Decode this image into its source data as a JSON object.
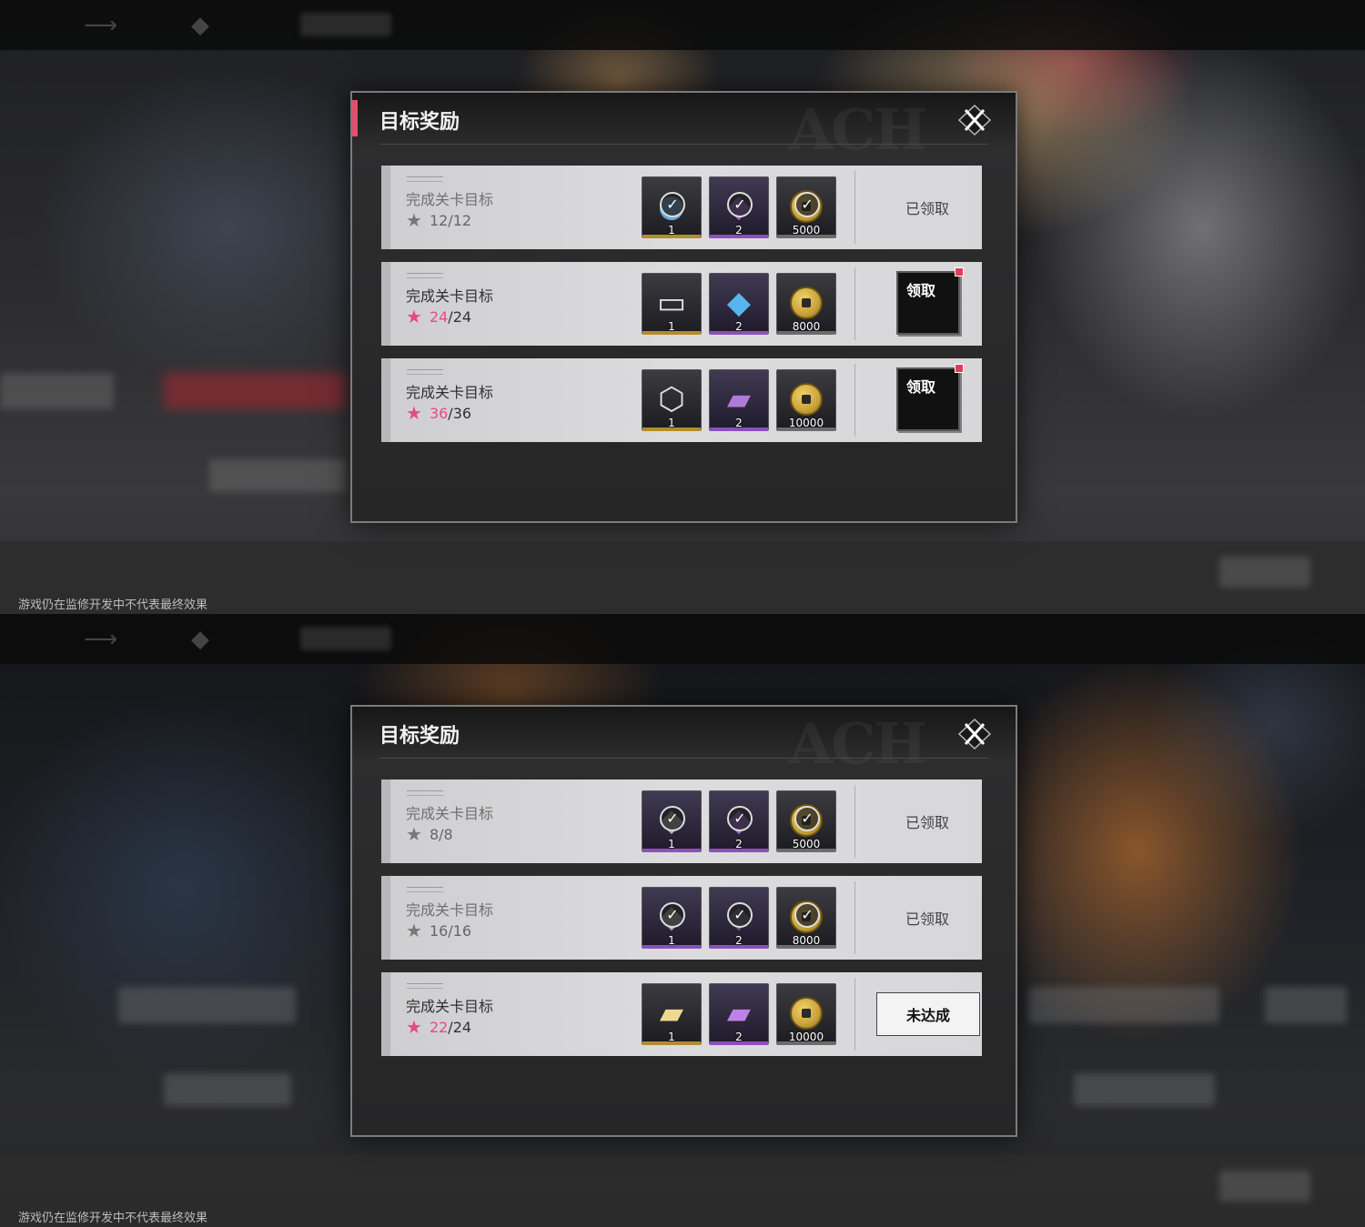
{
  "disclaimer": "游戏仍在监修开发中不代表最终效果",
  "colors": {
    "accent_pink": "#e64a86",
    "panel_bg": "#2e2e2f",
    "row_bg": "#d7d7d9",
    "badge_red": "#e23c58"
  },
  "panels": [
    {
      "title": "目标奖励",
      "rows": [
        {
          "goal": "完成关卡目标",
          "current": "12",
          "total": "12",
          "status": "已领取",
          "items": [
            {
              "icon": "blue-orb-icon",
              "qty": "1"
            },
            {
              "icon": "purple-shard-icon",
              "qty": "2"
            },
            {
              "icon": "gold-coin-icon",
              "qty": "5000"
            }
          ]
        },
        {
          "goal": "完成关卡目标",
          "current": "24",
          "total": "24",
          "status": "领取",
          "items": [
            {
              "icon": "ticket-icon",
              "qty": "1"
            },
            {
              "icon": "blue-crystal-icon",
              "qty": "2"
            },
            {
              "icon": "gold-coin-icon",
              "qty": "8000"
            }
          ]
        },
        {
          "goal": "完成关卡目标",
          "current": "36",
          "total": "36",
          "status": "领取",
          "items": [
            {
              "icon": "character-portrait-icon",
              "qty": "1"
            },
            {
              "icon": "purple-book-icon",
              "qty": "2"
            },
            {
              "icon": "gold-coin-icon",
              "qty": "10000"
            }
          ]
        }
      ]
    },
    {
      "title": "目标奖励",
      "rows": [
        {
          "goal": "完成关卡目标",
          "current": "8",
          "total": "8",
          "status": "已领取",
          "items": [
            {
              "icon": "grey-shard-icon",
              "qty": "1"
            },
            {
              "icon": "purple-shard-icon",
              "qty": "2"
            },
            {
              "icon": "gold-coin-icon",
              "qty": "5000"
            }
          ]
        },
        {
          "goal": "完成关卡目标",
          "current": "16",
          "total": "16",
          "status": "已领取",
          "items": [
            {
              "icon": "grey-shard-icon",
              "qty": "1"
            },
            {
              "icon": "dark-crystal-icon",
              "qty": "2"
            },
            {
              "icon": "gold-coin-icon",
              "qty": "8000"
            }
          ]
        },
        {
          "goal": "完成关卡目标",
          "current": "22",
          "total": "24",
          "status": "未达成",
          "items": [
            {
              "icon": "gold-card-icon",
              "qty": "1"
            },
            {
              "icon": "purple-card-icon",
              "qty": "2"
            },
            {
              "icon": "gold-coin-icon",
              "qty": "10000"
            }
          ]
        }
      ]
    }
  ]
}
